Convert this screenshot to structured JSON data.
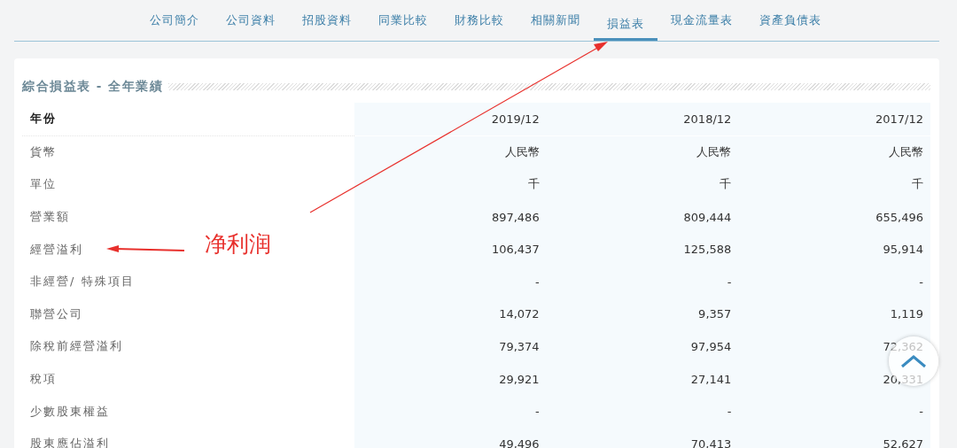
{
  "tabs": [
    {
      "label": "公司簡介",
      "selected": false
    },
    {
      "label": "公司資料",
      "selected": false
    },
    {
      "label": "招股資料",
      "selected": false
    },
    {
      "label": "同業比較",
      "selected": false
    },
    {
      "label": "財務比較",
      "selected": false
    },
    {
      "label": "相關新聞",
      "selected": false
    },
    {
      "label": "損益表",
      "selected": true
    },
    {
      "label": "現金流量表",
      "selected": false
    },
    {
      "label": "資產負債表",
      "selected": false
    }
  ],
  "section_title": "綜合損益表 - 全年業績",
  "table": {
    "header": {
      "label": "年份",
      "values": [
        "2019/12",
        "2018/12",
        "2017/12"
      ]
    },
    "rows": [
      {
        "label": "貨幣",
        "values": [
          "人民幣",
          "人民幣",
          "人民幣"
        ]
      },
      {
        "label": "單位",
        "values": [
          "千",
          "千",
          "千"
        ]
      },
      {
        "label": "營業額",
        "values": [
          "897,486",
          "809,444",
          "655,496"
        ]
      },
      {
        "label": "經營溢利",
        "values": [
          "106,437",
          "125,588",
          "95,914"
        ]
      },
      {
        "label": "非經營/ 特殊項目",
        "values": [
          "-",
          "-",
          "-"
        ]
      },
      {
        "label": "聯營公司",
        "values": [
          "14,072",
          "9,357",
          "1,119"
        ]
      },
      {
        "label": "除稅前經營溢利",
        "values": [
          "79,374",
          "97,954",
          "72,362"
        ]
      },
      {
        "label": "稅項",
        "values": [
          "29,921",
          "27,141",
          "20,331"
        ]
      },
      {
        "label": "少數股東權益",
        "values": [
          "-",
          "-",
          "-"
        ]
      },
      {
        "label": "股東應佔溢利",
        "values": [
          "49,496",
          "70,413",
          "52,627"
        ]
      }
    ]
  },
  "annotation": {
    "label": "净利润"
  }
}
